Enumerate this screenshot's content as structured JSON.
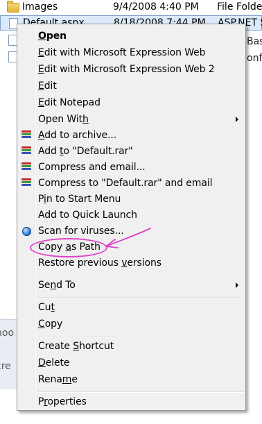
{
  "explorer": {
    "rows": [
      {
        "name": "Images",
        "date": "9/4/2008 4:40 PM",
        "type": "File Folde"
      },
      {
        "name": "Default.aspx",
        "date": "8/18/2008 7:44 PM",
        "type": "ASP.NET S"
      }
    ],
    "fragments": {
      "right1": "Bas",
      "right2": "onf",
      "left1": "noo",
      "left2": "cre"
    }
  },
  "menu": {
    "items": [
      {
        "pre": "",
        "u": "O",
        "post": "pen"
      },
      {
        "pre": "",
        "u": "E",
        "post": "dit with Microsoft Expression Web"
      },
      {
        "pre": "",
        "u": "E",
        "post": "dit with Microsoft Expression Web 2"
      },
      {
        "pre": "",
        "u": "E",
        "post": "dit"
      },
      {
        "pre": "",
        "u": "E",
        "post": "dit Notepad"
      },
      {
        "pre": "Open Wit",
        "u": "h",
        "post": ""
      },
      {
        "pre": "",
        "u": "A",
        "post": "dd to archive..."
      },
      {
        "pre": "Add ",
        "u": "t",
        "post": "o \"Default.rar\""
      },
      {
        "pre": "Compress and email...",
        "u": "",
        "post": ""
      },
      {
        "pre": "Compress to \"Default.rar\" and email",
        "u": "",
        "post": ""
      },
      {
        "pre": "P",
        "u": "i",
        "post": "n to Start Menu"
      },
      {
        "pre": "Add to Quick Launch",
        "u": "",
        "post": ""
      },
      {
        "pre": "Scan for viruses...",
        "u": "",
        "post": ""
      },
      {
        "pre": "Copy ",
        "u": "a",
        "post": "s Path"
      },
      {
        "pre": "Restore previous ",
        "u": "v",
        "post": "ersions"
      },
      {
        "pre": "Se",
        "u": "n",
        "post": "d To"
      },
      {
        "pre": "Cu",
        "u": "t",
        "post": ""
      },
      {
        "pre": "",
        "u": "C",
        "post": "opy"
      },
      {
        "pre": "Create ",
        "u": "S",
        "post": "hortcut"
      },
      {
        "pre": "",
        "u": "D",
        "post": "elete"
      },
      {
        "pre": "Rena",
        "u": "m",
        "post": "e"
      },
      {
        "pre": "P",
        "u": "r",
        "post": "operties"
      }
    ]
  },
  "icons": {
    "folder": "folder-icon",
    "rar": "winrar-icon",
    "scan": "antivirus-icon"
  },
  "colors": {
    "annotation": "#e040c8",
    "rar_red": "#c0282a",
    "rar_green": "#3c9a3c",
    "rar_blue": "#3b53b8"
  }
}
